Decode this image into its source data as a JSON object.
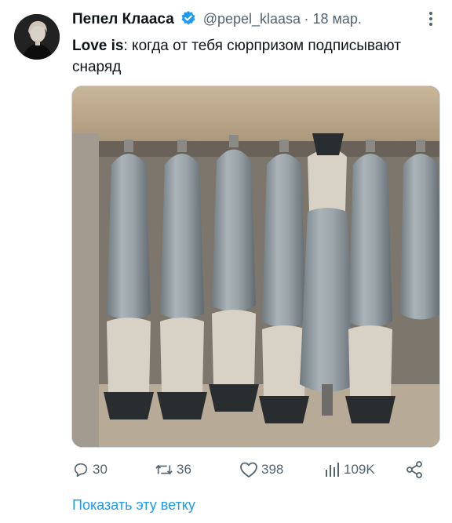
{
  "tweet": {
    "author_name": "Пепел Клааса",
    "handle": "@pepel_klaasa",
    "date": "· 18 мар.",
    "text_bold": "Love is",
    "text_rest": ": когда от тебя сюрпризом подписывают снаряд"
  },
  "actions": {
    "replies": "30",
    "retweets": "36",
    "likes": "398",
    "views": "109K"
  },
  "thread_link": "Показать эту ветку",
  "colors": {
    "accent": "#1d9bf0",
    "muted": "#536471",
    "text": "#0f1419"
  }
}
